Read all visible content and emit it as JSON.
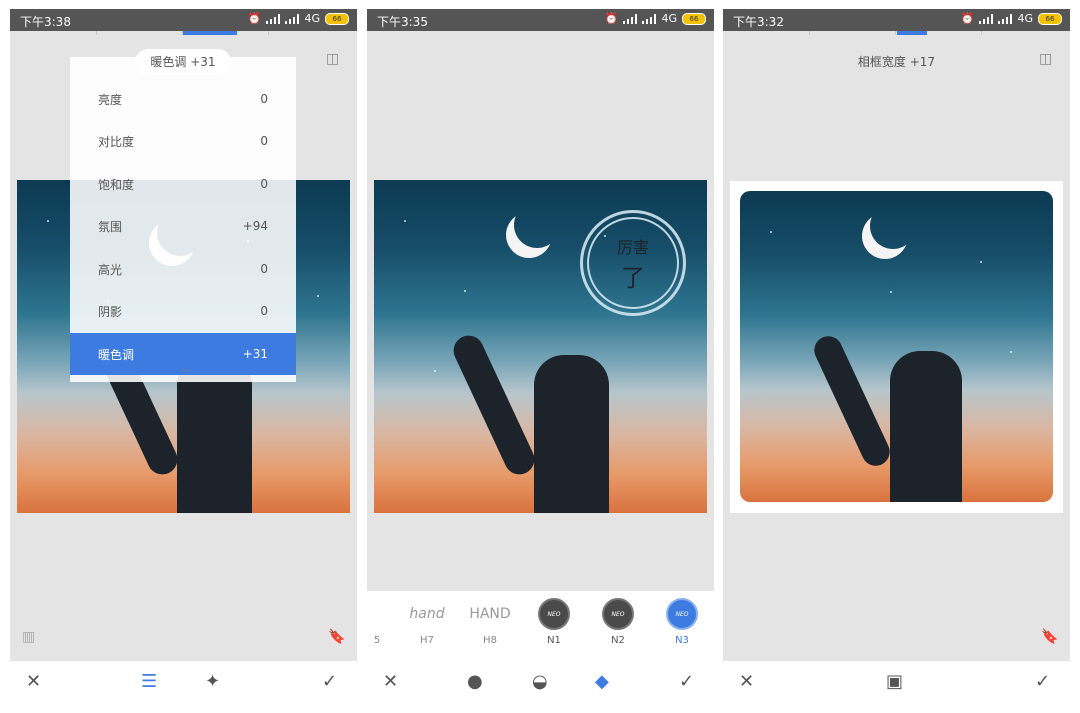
{
  "status": {
    "time1": "下午3:38",
    "time2": "下午3:35",
    "time3": "下午3:32",
    "network": "4G",
    "battery": "66"
  },
  "panel1": {
    "overlay_label": "暖色调 +31",
    "menu": [
      {
        "label": "亮度",
        "value": "0"
      },
      {
        "label": "对比度",
        "value": "0"
      },
      {
        "label": "饱和度",
        "value": "0"
      },
      {
        "label": "氛围",
        "value": "+94"
      },
      {
        "label": "高光",
        "value": "0"
      },
      {
        "label": "阴影",
        "value": "0"
      },
      {
        "label": "暖色调",
        "value": "+31"
      }
    ],
    "selected_index": 6,
    "icons": [
      "close-icon",
      "tune-icon",
      "magic-wand-icon",
      "check-icon"
    ]
  },
  "panel2": {
    "stamp_text_top": "厉害",
    "stamp_text_bottom": "了",
    "styles": [
      {
        "name": "5",
        "thumb": ""
      },
      {
        "name": "H7",
        "thumb": "hand"
      },
      {
        "name": "H8",
        "thumb": "HAND"
      },
      {
        "name": "N1",
        "thumb": "NEO"
      },
      {
        "name": "N2",
        "thumb": "NEO"
      },
      {
        "name": "N3",
        "thumb": "NEO"
      }
    ],
    "active_style": "N3",
    "icons": [
      "close-icon",
      "palette-icon",
      "drop-icon",
      "style-icon",
      "check-icon"
    ]
  },
  "panel3": {
    "overlay_label": "相框宽度 +17",
    "icons": [
      "close-icon",
      "frame-icon",
      "check-icon"
    ]
  },
  "colors": {
    "accent": "#3d7be0"
  }
}
